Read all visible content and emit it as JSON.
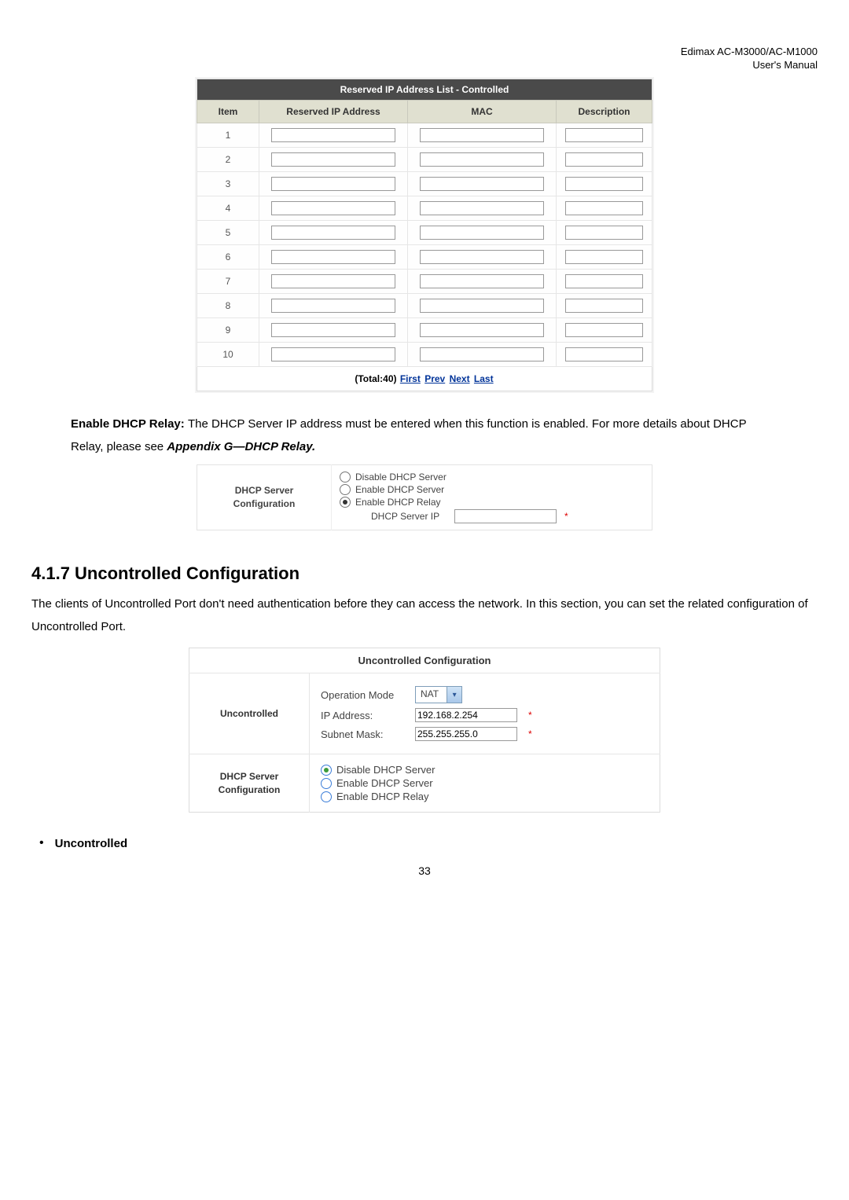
{
  "header": {
    "product": "Edimax  AC-M3000/AC-M1000",
    "subtitle": "User's  Manual"
  },
  "reserved": {
    "title": "Reserved IP Address List - Controlled",
    "cols": {
      "item": "Item",
      "ip": "Reserved IP Address",
      "mac": "MAC",
      "desc": "Description"
    },
    "rows": [
      "1",
      "2",
      "3",
      "4",
      "5",
      "6",
      "7",
      "8",
      "9",
      "10"
    ],
    "pager": {
      "total": "(Total:40)",
      "first": "First",
      "prev": "Prev",
      "next": "Next",
      "last": "Last"
    }
  },
  "relay_para": {
    "lead": "Enable DHCP Relay: ",
    "text": "The DHCP Server IP address must be entered when this function is enabled. For more details about DHCP Relay, please see ",
    "appendix": "Appendix G—DHCP Relay."
  },
  "dhcp_relay_box": {
    "label": "DHCP Server Configuration",
    "opt1": "Disable DHCP Server",
    "opt2": "Enable DHCP Server",
    "opt3": "Enable DHCP Relay",
    "serverip_label": "DHCP Server IP"
  },
  "section": {
    "heading": "4.1.7 Uncontrolled Configuration",
    "para": "The clients of Uncontrolled Port don't need authentication before they can access the network. In this section, you can set the related configuration of Uncontrolled Port."
  },
  "uncontrolled": {
    "title": "Uncontrolled Configuration",
    "row1_label": "Uncontrolled",
    "opmode_label": "Operation Mode",
    "opmode_value": "NAT",
    "ip_label": "IP Address:",
    "ip_value": "192.168.2.254",
    "mask_label": "Subnet Mask:",
    "mask_value": "255.255.255.0",
    "row2_label": "DHCP Server Configuration",
    "r2_opt1": "Disable DHCP Server",
    "r2_opt2": "Enable DHCP Server",
    "r2_opt3": "Enable DHCP Relay"
  },
  "bullet": {
    "text": "Uncontrolled"
  },
  "page_number": "33"
}
